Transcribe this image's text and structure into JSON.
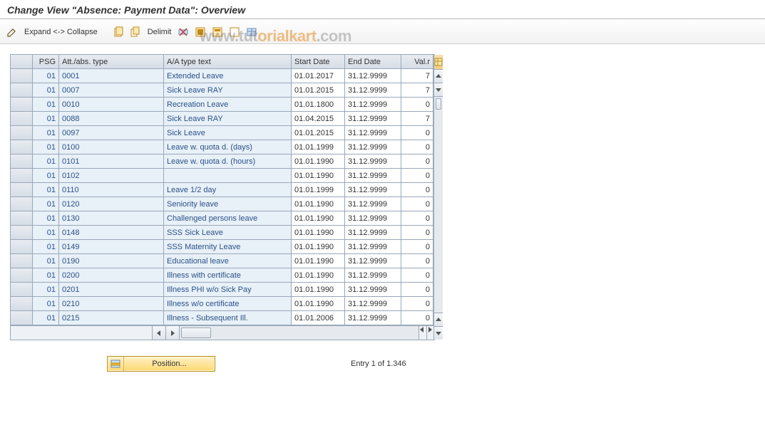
{
  "title": "Change View \"Absence: Payment Data\": Overview",
  "toolbar": {
    "expand_collapse": "Expand <-> Collapse",
    "delimit": "Delimit"
  },
  "watermark": {
    "part1": "www.tut",
    "part2": "orialkart",
    "part3": ".com"
  },
  "columns": {
    "psg": "PSG",
    "att": "Att./abs. type",
    "txt": "A/A type text",
    "start": "Start Date",
    "end": "End Date",
    "val": "Val.r"
  },
  "rows": [
    {
      "psg": "01",
      "att": "0001",
      "txt": "Extended Leave",
      "sd": "01.01.2017",
      "ed": "31.12.9999",
      "val": "7"
    },
    {
      "psg": "01",
      "att": "0007",
      "txt": "Sick Leave RAY",
      "sd": "01.01.2015",
      "ed": "31.12.9999",
      "val": "7"
    },
    {
      "psg": "01",
      "att": "0010",
      "txt": "Recreation Leave",
      "sd": "01.01.1800",
      "ed": "31.12.9999",
      "val": "0"
    },
    {
      "psg": "01",
      "att": "0088",
      "txt": "Sick Leave RAY",
      "sd": "01.04.2015",
      "ed": "31.12.9999",
      "val": "7"
    },
    {
      "psg": "01",
      "att": "0097",
      "txt": "Sick Leave",
      "sd": "01.01.2015",
      "ed": "31.12.9999",
      "val": "0"
    },
    {
      "psg": "01",
      "att": "0100",
      "txt": "Leave w. quota d. (days)",
      "sd": "01.01.1999",
      "ed": "31.12.9999",
      "val": "0"
    },
    {
      "psg": "01",
      "att": "0101",
      "txt": "Leave w. quota d. (hours)",
      "sd": "01.01.1990",
      "ed": "31.12.9999",
      "val": "0"
    },
    {
      "psg": "01",
      "att": "0102",
      "txt": "",
      "sd": "01.01.1990",
      "ed": "31.12.9999",
      "val": "0"
    },
    {
      "psg": "01",
      "att": "0110",
      "txt": "Leave 1/2 day",
      "sd": "01.01.1999",
      "ed": "31.12.9999",
      "val": "0"
    },
    {
      "psg": "01",
      "att": "0120",
      "txt": "Seniority leave",
      "sd": "01.01.1990",
      "ed": "31.12.9999",
      "val": "0"
    },
    {
      "psg": "01",
      "att": "0130",
      "txt": "Challenged persons leave",
      "sd": "01.01.1990",
      "ed": "31.12.9999",
      "val": "0"
    },
    {
      "psg": "01",
      "att": "0148",
      "txt": "SSS Sick Leave",
      "sd": "01.01.1990",
      "ed": "31.12.9999",
      "val": "0"
    },
    {
      "psg": "01",
      "att": "0149",
      "txt": "SSS Maternity Leave",
      "sd": "01.01.1990",
      "ed": "31.12.9999",
      "val": "0"
    },
    {
      "psg": "01",
      "att": "0190",
      "txt": "Educational leave",
      "sd": "01.01.1990",
      "ed": "31.12.9999",
      "val": "0"
    },
    {
      "psg": "01",
      "att": "0200",
      "txt": "Illness with certificate",
      "sd": "01.01.1990",
      "ed": "31.12.9999",
      "val": "0"
    },
    {
      "psg": "01",
      "att": "0201",
      "txt": "Illness PHI w/o Sick Pay",
      "sd": "01.01.1990",
      "ed": "31.12.9999",
      "val": "0"
    },
    {
      "psg": "01",
      "att": "0210",
      "txt": "Illness w/o certificate",
      "sd": "01.01.1990",
      "ed": "31.12.9999",
      "val": "0"
    },
    {
      "psg": "01",
      "att": "0215",
      "txt": "Illness - Subsequent Ill.",
      "sd": "01.01.2006",
      "ed": "31.12.9999",
      "val": "0"
    }
  ],
  "footer": {
    "position_label": "Position...",
    "entry_text": "Entry 1 of 1.346"
  }
}
